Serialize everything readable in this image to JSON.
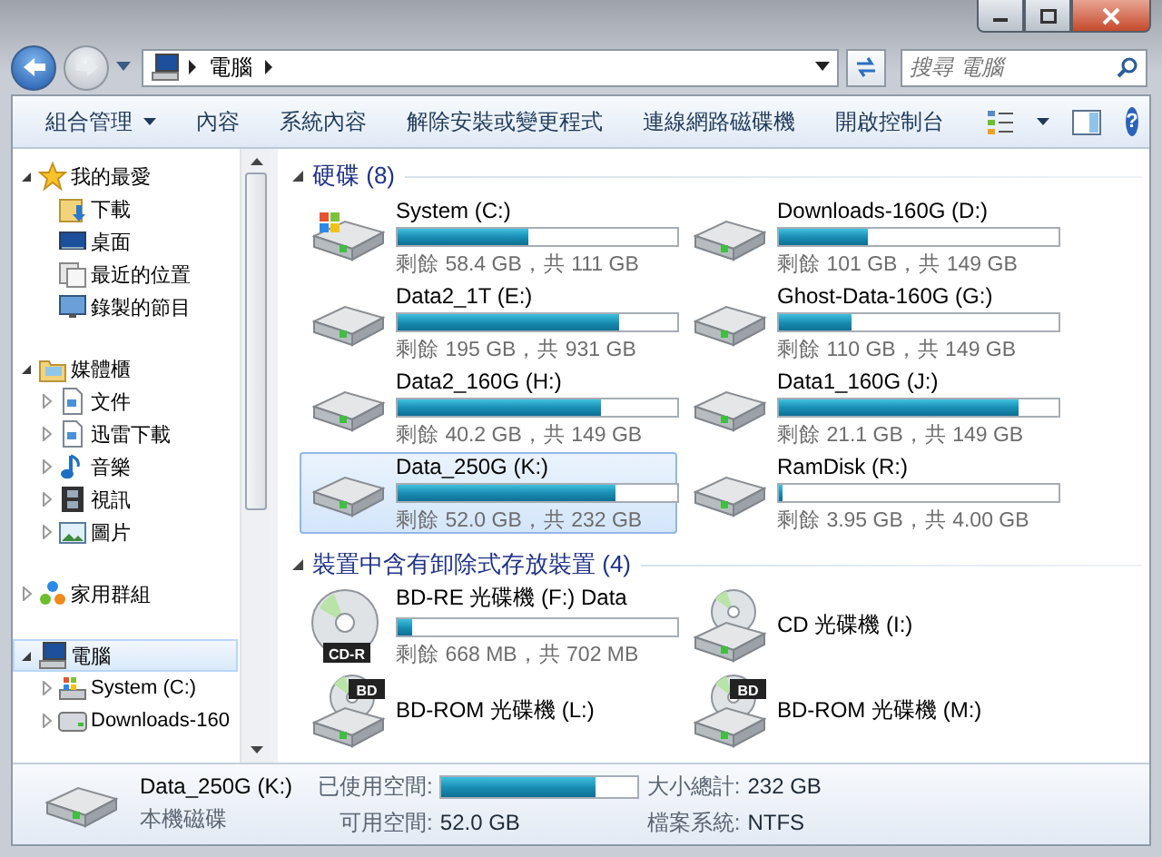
{
  "navigation": {
    "back": {
      "disabled": false
    },
    "forward": {
      "disabled": true
    }
  },
  "address": {
    "crumbs": [
      {
        "label": "電腦"
      }
    ]
  },
  "search": {
    "placeholder": "搜尋 電腦"
  },
  "help": {
    "label": "?"
  },
  "toolbar": {
    "items": [
      {
        "label": "組合管理",
        "kind": "menu"
      },
      {
        "label": "內容",
        "kind": "button"
      },
      {
        "label": "系統內容",
        "kind": "button"
      },
      {
        "label": "解除安裝或變更程式",
        "kind": "button"
      },
      {
        "label": "連線網路磁碟機",
        "kind": "button"
      },
      {
        "label": "開啟控制台",
        "kind": "button"
      }
    ]
  },
  "sidebar": {
    "items": [
      {
        "label": "我的最愛",
        "kind": "star",
        "expanded": true,
        "selected": false,
        "children": [
          {
            "label": "下載",
            "kind": "download-folder",
            "selected": false
          },
          {
            "label": "桌面",
            "kind": "desktop",
            "selected": false
          },
          {
            "label": "最近的位置",
            "kind": "recent",
            "selected": false
          },
          {
            "label": "錄製的節目",
            "kind": "tv",
            "selected": false
          }
        ]
      },
      {
        "label": "媒體櫃",
        "kind": "library",
        "expanded": true,
        "selected": false,
        "children": [
          {
            "label": "文件",
            "kind": "document",
            "expanded": false,
            "selected": false
          },
          {
            "label": "迅雷下載",
            "kind": "document",
            "expanded": false,
            "selected": false
          },
          {
            "label": "音樂",
            "kind": "music",
            "expanded": false,
            "selected": false
          },
          {
            "label": "視訊",
            "kind": "video",
            "expanded": false,
            "selected": false
          },
          {
            "label": "圖片",
            "kind": "picture",
            "expanded": false,
            "selected": false
          }
        ]
      },
      {
        "label": "家用群組",
        "kind": "homegroup",
        "expanded": false,
        "selected": false
      },
      {
        "label": "電腦",
        "kind": "computer",
        "expanded": true,
        "selected": true,
        "children": [
          {
            "label": "System (C:)",
            "kind": "system-drive",
            "expanded": false,
            "selected": false
          },
          {
            "label": "Downloads-160",
            "kind": "drive",
            "expanded": false,
            "selected": false
          }
        ]
      }
    ]
  },
  "groups": [
    {
      "title": "硬碟 (8)",
      "expanded": true,
      "items": [
        {
          "name": "System (C:)",
          "kind": "system-hdd",
          "level": 0.47,
          "free": "剩餘 58.4 GB，共 111 GB",
          "selected": false
        },
        {
          "name": "Downloads-160G (D:)",
          "kind": "hdd",
          "level": 0.32,
          "free": "剩餘 101 GB，共 149 GB",
          "selected": false
        },
        {
          "name": "Data2_1T (E:)",
          "kind": "hdd",
          "level": 0.79,
          "free": "剩餘 195 GB，共 931 GB",
          "selected": false
        },
        {
          "name": "Ghost-Data-160G (G:)",
          "kind": "hdd",
          "level": 0.26,
          "free": "剩餘 110 GB，共 149 GB",
          "selected": false
        },
        {
          "name": "Data2_160G (H:)",
          "kind": "hdd",
          "level": 0.73,
          "free": "剩餘 40.2 GB，共 149 GB",
          "selected": false
        },
        {
          "name": "Data1_160G (J:)",
          "kind": "hdd",
          "level": 0.86,
          "free": "剩餘 21.1 GB，共 149 GB",
          "selected": false
        },
        {
          "name": "Data_250G (K:)",
          "kind": "hdd",
          "level": 0.78,
          "free": "剩餘 52.0 GB，共 232 GB",
          "selected": true
        },
        {
          "name": "RamDisk (R:)",
          "kind": "hdd",
          "level": 0.01,
          "free": "剩餘 3.95 GB，共 4.00 GB",
          "selected": false
        }
      ]
    },
    {
      "title": "裝置中含有卸除式存放裝置 (4)",
      "expanded": true,
      "items": [
        {
          "name": "BD-RE 光碟機 (F:) Data",
          "kind": "disc",
          "badge": "CD-R",
          "level": 0.05,
          "free": "剩餘 668 MB，共 702 MB",
          "selected": false
        },
        {
          "name": "CD 光碟機 (I:)",
          "kind": "optical-drive",
          "selected": false
        },
        {
          "name": "BD-ROM 光碟機 (L:)",
          "kind": "optical-drive",
          "badge": "BD",
          "selected": false
        },
        {
          "name": "BD-ROM 光碟機 (M:)",
          "kind": "optical-drive",
          "badge": "BD",
          "selected": false
        }
      ]
    }
  ],
  "details": {
    "name": "Data_250G (K:)",
    "type": "本機磁碟",
    "fields": [
      {
        "label": "已使用空間:",
        "kind": "bar",
        "level": 0.78
      },
      {
        "label": "大小總計:",
        "kind": "text",
        "value": "232 GB"
      },
      {
        "label": "可用空間:",
        "kind": "text",
        "value": "52.0 GB"
      },
      {
        "label": "檔案系統:",
        "kind": "text",
        "value": "NTFS"
      }
    ]
  }
}
